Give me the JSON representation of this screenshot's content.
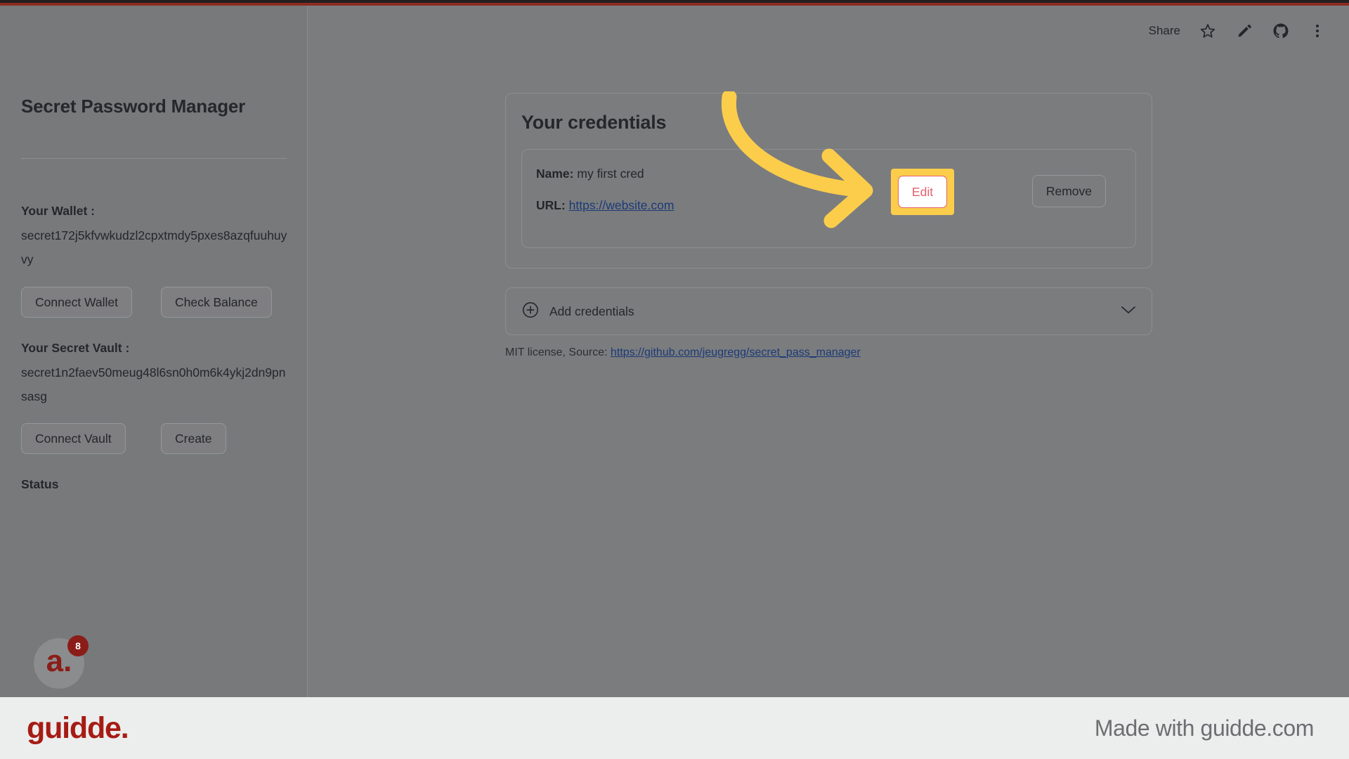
{
  "top_accent_color": "#8a2c22",
  "overlay_color": "#7b7c7e",
  "topbar": {
    "share_label": "Share",
    "icons": [
      "star-icon",
      "pencil-icon",
      "github-icon",
      "more-vertical-icon"
    ]
  },
  "sidebar": {
    "title": "Secret Password Manager",
    "wallet_label": "Your Wallet :",
    "wallet_address": "secret172j5kfvwkudzl2cpxtmdy5pxes8azqfuuhuyvy",
    "connect_wallet_label": "Connect Wallet",
    "check_balance_label": "Check Balance",
    "vault_label": "Your Secret Vault :",
    "vault_address": "secret1n2faev50meug48l6sn0h0m6k4ykj2dn9pnsasg",
    "connect_vault_label": "Connect Vault",
    "create_label": "Create",
    "status_label": "Status",
    "avatar_letter": "a.",
    "avatar_badge": "8"
  },
  "main": {
    "card_title": "Your credentials",
    "credential": {
      "name_label": "Name:",
      "name_value": "my first cred",
      "url_label": "URL:",
      "url_value": "https://website.com",
      "edit_label": "Edit",
      "remove_label": "Remove"
    },
    "add_credentials_label": "Add credentials",
    "license_prefix": "MIT license, Source:",
    "license_link": "https://github.com/jeugregg/secret_pass_manager"
  },
  "annotation": {
    "highlight_color": "#fbcd4b",
    "arrow_color": "#fbcd4b",
    "target": "edit-button"
  },
  "footer": {
    "logo_text": "guidde.",
    "made_with": "Made with guidde.com",
    "logo_color": "#a51c14"
  }
}
